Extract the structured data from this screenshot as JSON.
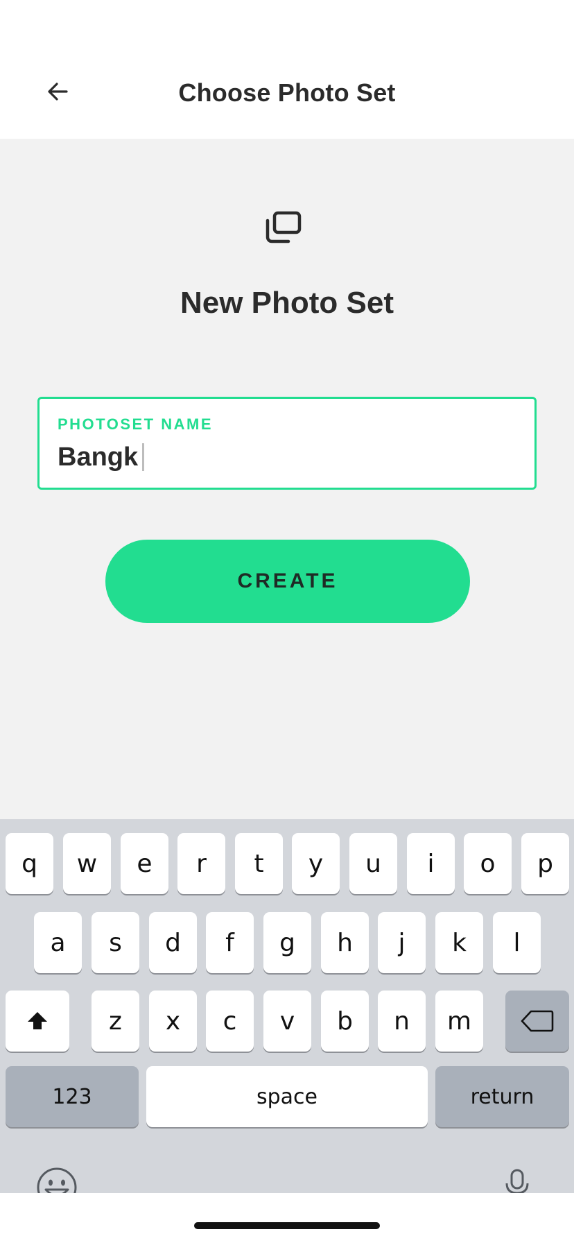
{
  "header": {
    "title": "Choose Photo Set",
    "back_icon": "arrow-left-icon"
  },
  "main": {
    "icon": "photo-set-stack-icon",
    "title": "New Photo Set",
    "field": {
      "label": "PHOTOSET NAME",
      "value": "Bangk"
    },
    "create_label": "CREATE"
  },
  "colors": {
    "accent": "#22dd90",
    "background": "#f2f2f2",
    "keyboard": "#d3d6db"
  },
  "keyboard": {
    "row1": [
      "q",
      "w",
      "e",
      "r",
      "t",
      "y",
      "u",
      "i",
      "o",
      "p"
    ],
    "row2": [
      "a",
      "s",
      "d",
      "f",
      "g",
      "h",
      "j",
      "k",
      "l"
    ],
    "row3": [
      "z",
      "x",
      "c",
      "v",
      "b",
      "n",
      "m"
    ],
    "shift_icon": "shift-icon",
    "delete_icon": "backspace-icon",
    "numbers_label": "123",
    "space_label": "space",
    "return_label": "return",
    "emoji_icon": "emoji-icon",
    "dictation_icon": "dictation-icon"
  }
}
